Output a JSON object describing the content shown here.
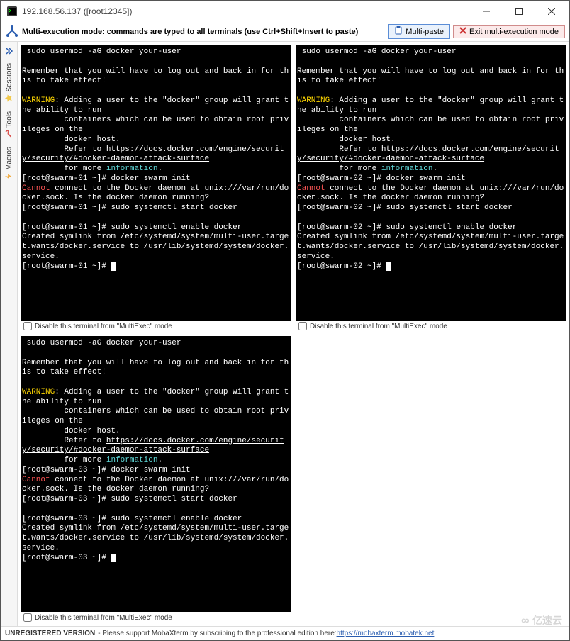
{
  "window": {
    "title": "192.168.56.137 ([root12345])"
  },
  "modebar": {
    "text": "Multi-execution mode: commands are typed to all terminals (use Ctrl+Shift+Insert to paste)",
    "multipaste": "Multi-paste",
    "exit": "Exit multi-execution mode"
  },
  "sidebar": {
    "sessions": "Sessions",
    "tools": "Tools",
    "macros": "Macros"
  },
  "termcheck_label": "Disable this terminal from \"MultiExec\" mode",
  "terminals": [
    {
      "host": "swarm-01"
    },
    {
      "host": "swarm-02"
    },
    {
      "host": "swarm-03"
    }
  ],
  "lines": {
    "cmd_usermod": " sudo usermod -aG docker your-user",
    "remember": "Remember that you will have to log out and back in for this to take effect!",
    "warning_label": "WARNING",
    "warning_body": ": Adding a user to the \"docker\" group will grant the ability to run",
    "containers": "         containers which can be used to obtain root privileges on the",
    "dockerhost": "         docker host.",
    "refer": "         Refer to ",
    "url1": "https://docs.docker.com/engine/security/security/#docker-daemon-attack-surface",
    "formore": "         for more ",
    "information": "information",
    "dot": ".",
    "prompt_pre": "[root@",
    "prompt_post": " ~]# ",
    "cmd_swarm": "docker swarm init",
    "cannot_label": "Cannot",
    "cannot_body": " connect to the Docker daemon at unix:///var/run/docker.sock. Is the docker daemon running?",
    "cmd_start": "sudo systemctl start docker",
    "cmd_enable": "sudo systemctl enable docker",
    "symlink": "Created symlink from /etc/systemd/system/multi-user.target.wants/docker.service to /usr/lib/systemd/system/docker.service."
  },
  "statusbar": {
    "bold": "UNREGISTERED VERSION",
    "text": " - Please support MobaXterm by subscribing to the professional edition here: ",
    "link": "https://mobaxterm.mobatek.net"
  },
  "watermark": "亿速云"
}
